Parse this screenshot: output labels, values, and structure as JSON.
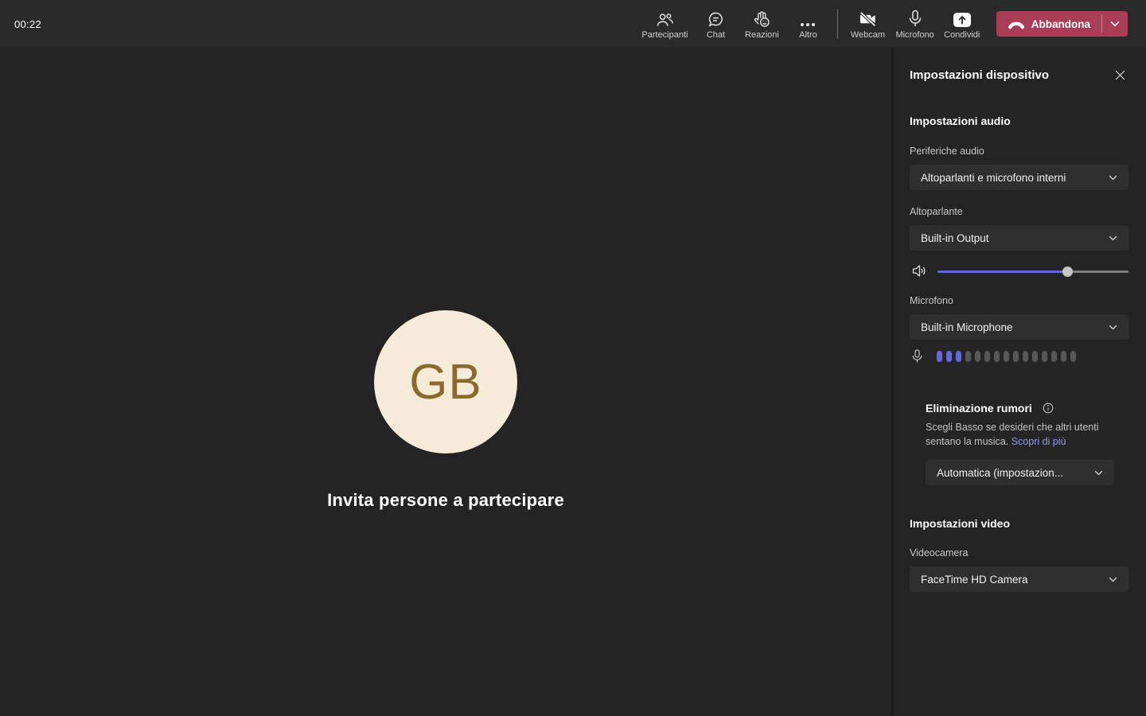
{
  "meeting": {
    "timer": "00:22",
    "stage": {
      "avatar_initials": "GB",
      "avatar_bg": "#f6ead9",
      "avatar_fg": "#8a6b2d",
      "invite_text": "Invita persone a partecipare"
    }
  },
  "toolbar": {
    "participants_label": "Partecipanti",
    "chat_label": "Chat",
    "reactions_label": "Reazioni",
    "more_label": "Altro",
    "webcam_label": "Webcam",
    "mic_label": "Microfono",
    "share_label": "Condividi",
    "leave_label": "Abbandona",
    "leave_color": "#a93d55"
  },
  "panel": {
    "title": "Impostazioni dispositivo",
    "accent": "#6466e3",
    "audio": {
      "heading": "Impostazioni audio",
      "devices_label": "Periferiche audio",
      "devices_value": "Altoparlanti e microfono interni",
      "speaker_label": "Altoparlante",
      "speaker_value": "Built-in Output",
      "volume_percent": 68,
      "mic_label": "Microfono",
      "mic_value": "Built-in Microphone",
      "mic_level_active_bars": 3,
      "mic_level_total_bars": 15
    },
    "noise": {
      "heading": "Eliminazione rumori",
      "description": "Scegli Basso se desideri che altri utenti sentano la musica. ",
      "link_label": "Scopri di più",
      "value": "Automatica (impostazion..."
    },
    "video": {
      "heading": "Impostazioni video",
      "camera_label": "Videocamera",
      "camera_value": "FaceTime HD Camera"
    }
  }
}
